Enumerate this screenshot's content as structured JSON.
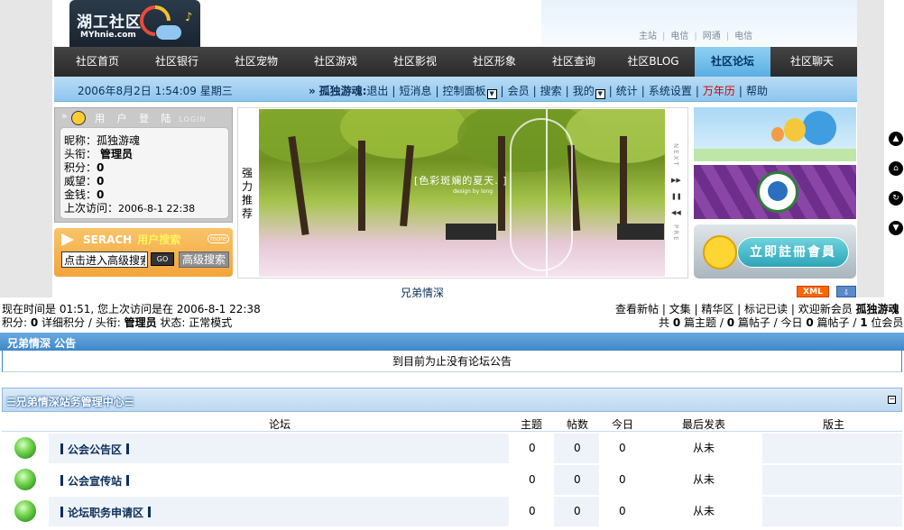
{
  "header": {
    "logo_title": "湖工社区",
    "logo_domain": "MYhnie.com",
    "top_links": [
      "主站",
      "电信",
      "网通",
      "电信"
    ]
  },
  "nav": {
    "items": [
      "社区首页",
      "社区银行",
      "社区宠物",
      "社区游戏",
      "社区影视",
      "社区形象",
      "社区查询",
      "社区BLOG",
      "社区论坛",
      "社区聊天"
    ],
    "active": "社区论坛"
  },
  "subbar": {
    "datetime": "2006年8月2日 1:54:09  星期三",
    "prefix": "»",
    "username": "孤独游魂:",
    "links": [
      "退出",
      "短消息",
      "控制面板",
      "会员",
      "搜索",
      "我的",
      "统计",
      "系统设置",
      "万年历",
      "帮助"
    ]
  },
  "login_box": {
    "title": "用 户 登 陆",
    "title_en": "LOGIN",
    "nickname_label": "昵称：",
    "nickname": "孤独游魂",
    "rank_label": "头衔：",
    "rank": "管理员",
    "points_label": "积分：",
    "points": "0",
    "prestige_label": "威望：",
    "prestige": "0",
    "money_label": "金钱：",
    "money": "0",
    "last_visit_label": "上次访问：",
    "last_visit": "2006-8-1 22:38"
  },
  "search_box": {
    "title": "SERACH",
    "title_cn": "用户搜索",
    "more": "more",
    "input_value": "点击进入高级搜索",
    "go": "GO",
    "advanced": "高级搜索"
  },
  "banner": {
    "side_label": "强力推荐",
    "text": "[色彩斑斓的夏天. ]",
    "credit": "design by long",
    "next": "NEXT",
    "prev": "PRE",
    "caption": "兄弟情深"
  },
  "ads": {
    "register": "立即註冊會員"
  },
  "badges": {
    "xml": "XML",
    "rss": "⇩"
  },
  "stats": {
    "line1_left": "现在时间是 01:51, 您上次访问是在 2006-8-1 22:38",
    "line1_right_links": "查看新帖 | 文集 | 精华区 | 标记已读 | 欢迎新会员",
    "line1_right_user": "孤独游魂",
    "line2_left_a": "积分: ",
    "line2_left_points": "0",
    "line2_left_b": " 详细积分 / 头衔: ",
    "line2_left_rank": "管理员",
    "line2_left_c": " 状态: 正常模式",
    "line2_right": {
      "p1": "共 ",
      "topics": "0",
      "p2": " 篇主题 / ",
      "posts": "0",
      "p3": " 篇帖子 / 今日 ",
      "today": "0",
      "p4": " 篇帖子 / ",
      "online": "1",
      "p5": " 位会员"
    }
  },
  "notice": {
    "title": "兄弟情深 公告",
    "body": "到目前为止没有论坛公告"
  },
  "category": {
    "title": "☰兄弟情深站务管理中心☰",
    "collapse": "−"
  },
  "columns": {
    "forum": "论坛",
    "topics": "主题",
    "posts": "帖数",
    "today": "今日",
    "last": "最后发表",
    "moderator": "版主"
  },
  "forums": [
    {
      "name": "公会公告区",
      "topics": "0",
      "posts": "0",
      "today": "0",
      "last": "从未"
    },
    {
      "name": "公会宣传站",
      "topics": "0",
      "posts": "0",
      "today": "0",
      "last": "从未"
    },
    {
      "name": "论坛职务申请区",
      "topics": "0",
      "posts": "0",
      "today": "0",
      "last": "从未"
    }
  ]
}
